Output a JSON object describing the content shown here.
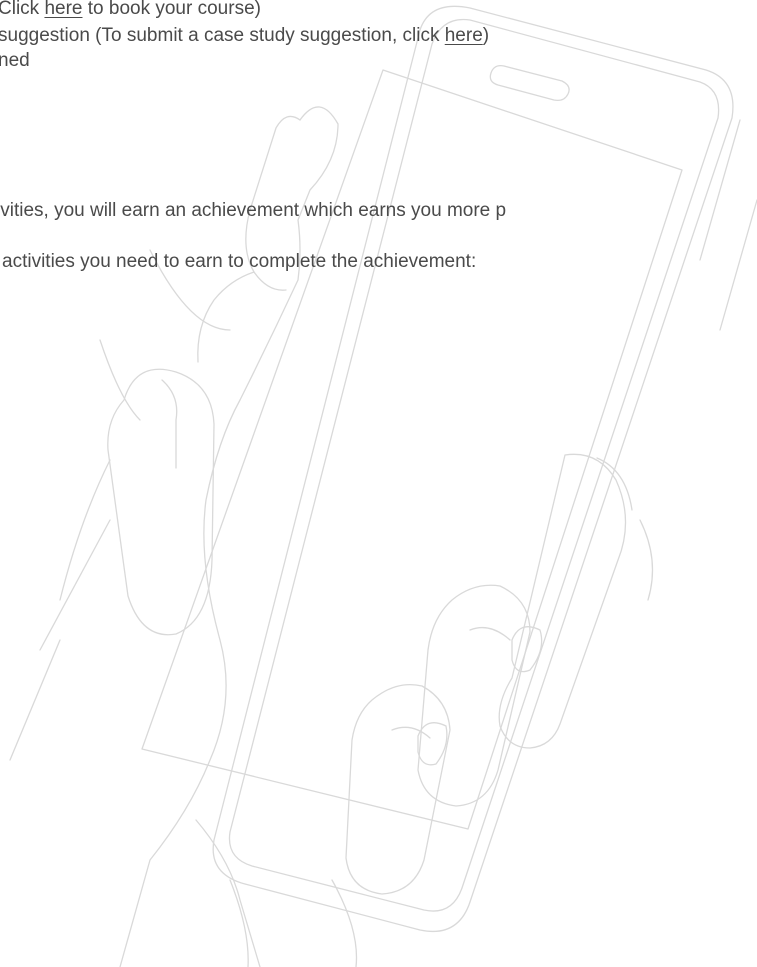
{
  "lines": {
    "line1": {
      "prefix": "Click ",
      "link": "here",
      "suffix": " to book your course)"
    },
    "line2": {
      "prefix": "suggestion (To submit a case study suggestion, click ",
      "link": "here",
      "suffix": ")"
    },
    "line3": {
      "text": "ned"
    },
    "line4": {
      "text": "ivities, you will earn an achievement which earns you more p"
    },
    "line5": {
      "text": "activities you need to earn to complete the achievement:"
    }
  },
  "colors": {
    "text": "#4a4a4a",
    "illustration_stroke": "#d9d9d9",
    "background": "#ffffff"
  },
  "illustration": {
    "icon": "hand-holding-phone-icon"
  }
}
